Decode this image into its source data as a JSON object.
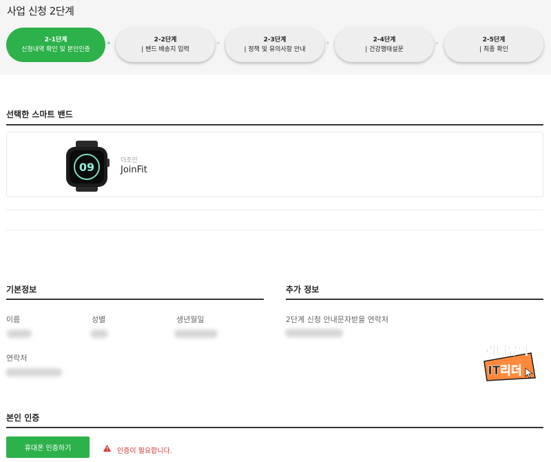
{
  "page": {
    "title": "사업 신청 2단계"
  },
  "steps": [
    {
      "num": "2-1단계",
      "label": "신청내역 확인 및 본인인증",
      "active": true
    },
    {
      "num": "2-2단계",
      "label": "|   밴드 배송지 입력",
      "active": false
    },
    {
      "num": "2-3단계",
      "label": "|   정책 및 유의사항 안내",
      "active": false
    },
    {
      "num": "2-4단계",
      "label": "|   건강행태설문",
      "active": false
    },
    {
      "num": "2-5단계",
      "label": "|   최종 확인",
      "active": false
    }
  ],
  "step_arrow": "»",
  "band_section": {
    "title": "선택한 스마트 밴드",
    "maker": "더조인",
    "name": "JoinFit",
    "watch_display": "09"
  },
  "basic_info": {
    "title": "기본정보",
    "name_label": "이름",
    "gender_label": "성별",
    "birth_label": "생년월일",
    "contact_label": "연락처"
  },
  "extra_info": {
    "title": "추가 정보",
    "contact_label": "2단계 신청 안내문자받을 연락처"
  },
  "watermark": {
    "line1": "리더유의",
    "line2": "IT리더"
  },
  "verification": {
    "title": "본인 인증",
    "button_label": "휴대폰 인증하기",
    "warning_text": "인증이 필요합니다."
  },
  "colors": {
    "accent": "#2db14a",
    "warning": "#d63030"
  }
}
